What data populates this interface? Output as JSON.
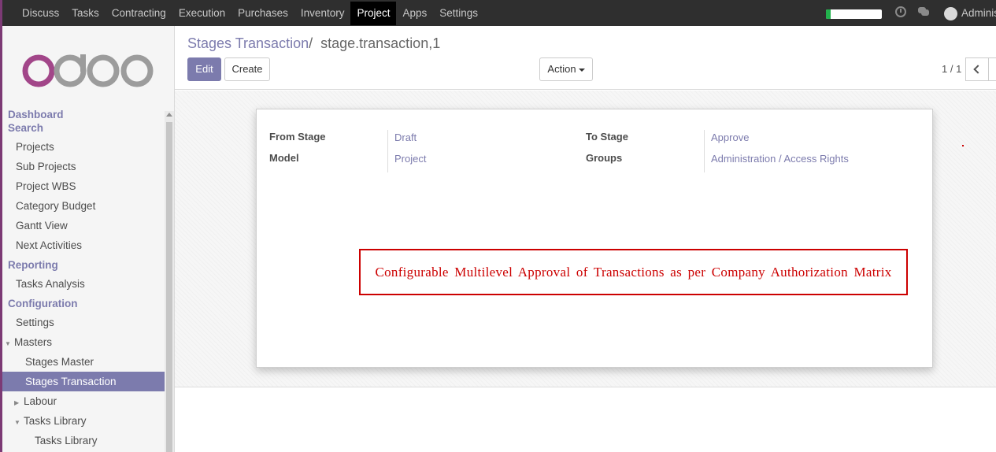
{
  "topnav": {
    "items": [
      "Discuss",
      "Tasks",
      "Contracting",
      "Execution",
      "Purchases",
      "Inventory",
      "Project",
      "Apps",
      "Settings"
    ],
    "active": "Project",
    "progress_percent": 8,
    "user": "Adminis"
  },
  "sidebar": {
    "logo": "odoo",
    "menu": [
      {
        "kind": "header",
        "label": "Dashboard"
      },
      {
        "kind": "header",
        "label": "Search"
      },
      {
        "kind": "item",
        "label": "Projects"
      },
      {
        "kind": "item",
        "label": "Sub Projects"
      },
      {
        "kind": "item",
        "label": "Project WBS"
      },
      {
        "kind": "item",
        "label": "Category Budget"
      },
      {
        "kind": "item",
        "label": "Gantt View"
      },
      {
        "kind": "item",
        "label": "Next Activities"
      },
      {
        "kind": "header",
        "label": "Reporting"
      },
      {
        "kind": "item",
        "label": "Tasks Analysis"
      },
      {
        "kind": "header",
        "label": "Configuration"
      },
      {
        "kind": "item",
        "label": "Settings"
      },
      {
        "kind": "item",
        "label": "Masters",
        "toggle": "expanded"
      },
      {
        "kind": "sub",
        "label": "Stages Master"
      },
      {
        "kind": "sub",
        "label": "Stages Transaction",
        "active": true
      },
      {
        "kind": "item",
        "label": "Labour",
        "toggle": "collapsed",
        "indent": true
      },
      {
        "kind": "item",
        "label": "Tasks Library",
        "toggle": "expanded",
        "indent": true
      },
      {
        "kind": "sub2",
        "label": "Tasks Library"
      }
    ]
  },
  "control_panel": {
    "breadcrumb_link": "Stages Transaction",
    "breadcrumb_sep": "/",
    "breadcrumb_current": "stage.transaction,1",
    "edit_label": "Edit",
    "create_label": "Create",
    "action_label": "Action",
    "pager": "1 / 1"
  },
  "form": {
    "from_stage_label": "From Stage",
    "from_stage_value": "Draft",
    "model_label": "Model",
    "model_value": "Project",
    "to_stage_label": "To Stage",
    "to_stage_value": "Approve",
    "groups_label": "Groups",
    "groups_value": "Administration / Access Rights"
  },
  "banner": {
    "text": "Configurable Multilevel Approval of Transactions as per Company Authorization Matrix",
    "color": "#cc0000"
  },
  "colors": {
    "accent": "#7c7bad",
    "topbar": "#2f2f2f",
    "brand": "#7c3a75"
  }
}
